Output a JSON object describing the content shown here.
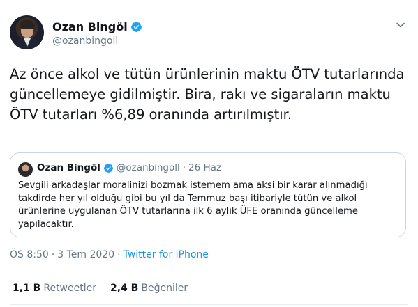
{
  "author": {
    "name": "Ozan Bingöl",
    "handle": "@ozanbingoll"
  },
  "tweet": {
    "text": "Az önce alkol ve tütün ürünlerinin maktu ÖTV tutarlarında güncellemeye gidilmiştir. Bira, rakı ve sigaraların maktu ÖTV tutarları %6,89 oranında artırılmıştır."
  },
  "quoted_tweet": {
    "name": "Ozan Bingöl",
    "handle": "@ozanbingoll",
    "separator": "·",
    "date": "26 Haz",
    "text": "Sevgili arkadaşlar moralinizi bozmak istemem ama aksi bir karar alınmadığı takdirde her yıl olduğu gibi bu yıl da Temmuz başı itibariyle tütün ve alkol ürünlerine uygulanan ÖTV tutarlarına ilk 6 aylık ÜFE oranında güncelleme yapılacaktır."
  },
  "meta": {
    "time": "ÖS 8:50",
    "separator": "·",
    "date": "3 Tem 2020",
    "source": "Twitter for iPhone"
  },
  "stats": {
    "retweets_count": "1,1 B",
    "retweets_label": "Retweetler",
    "likes_count": "2,4 B",
    "likes_label": "Beğeniler"
  },
  "icons": {
    "verified": "verified-badge-icon",
    "more": "chevron-down-icon"
  },
  "colors": {
    "accent": "#1da1f2",
    "link": "#1b95e0",
    "secondary_text": "#657786",
    "border": "#ccd6dd"
  }
}
